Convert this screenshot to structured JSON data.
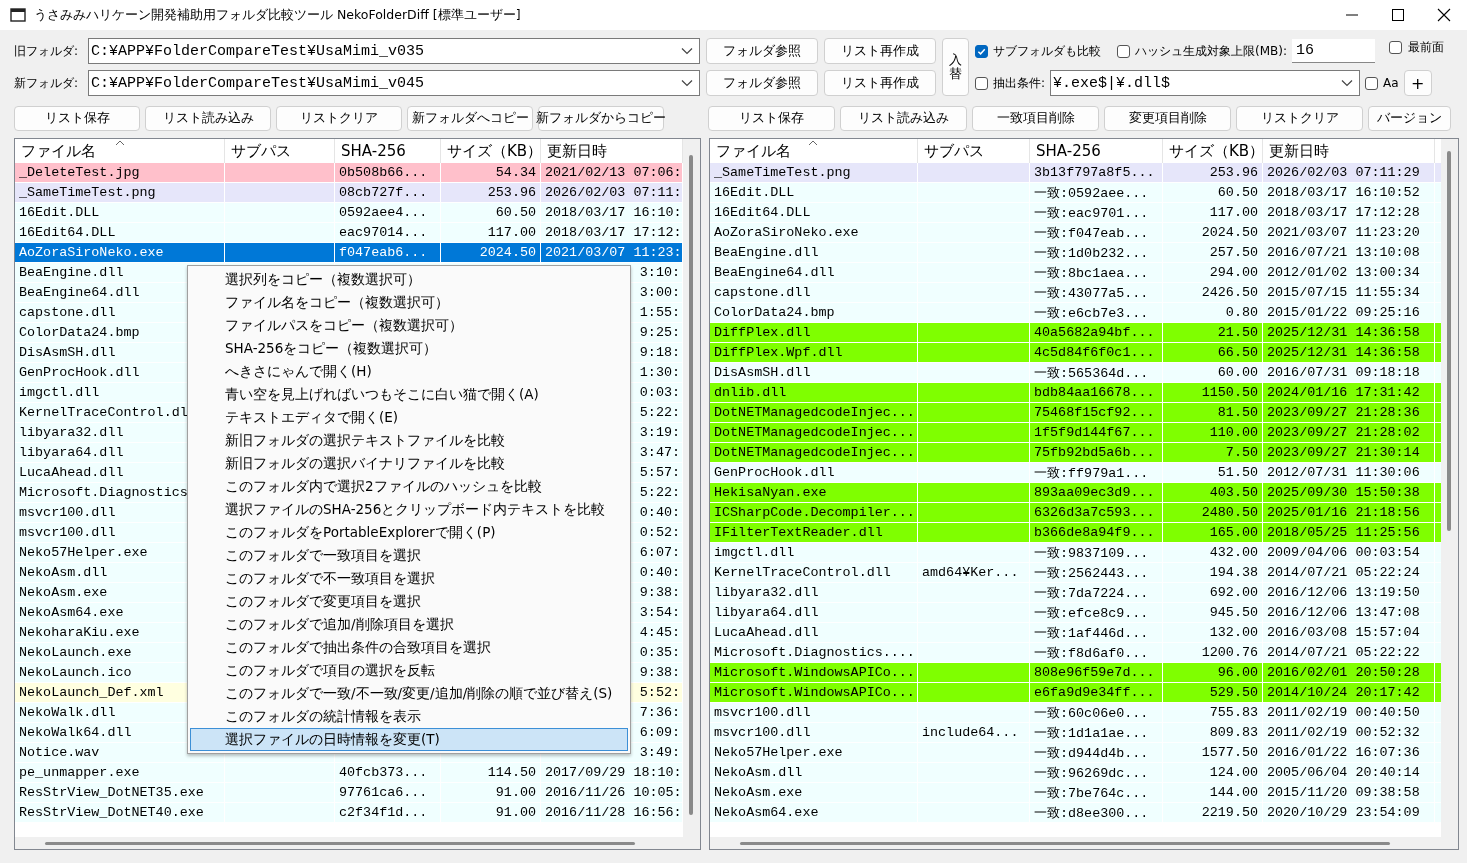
{
  "window": {
    "title": "うさみみハリケーン開発補助用フォルダ比較ツール NekoFolderDiff [標準ユーザー]"
  },
  "old_folder": {
    "label": "旧フォルダ:",
    "value": "C:¥APP¥FolderCompareTest¥UsaMimi_v035",
    "buttons": [
      "フォルダ参照",
      "リスト再作成"
    ]
  },
  "new_folder": {
    "label": "新フォルダ:",
    "value": "C:¥APP¥FolderCompareTest¥UsaMimi_v045",
    "buttons": [
      "フォルダ参照",
      "リスト再作成"
    ]
  },
  "swap_button": "入替",
  "compare_subfolders": {
    "label": "サブフォルダも比較",
    "checked": true
  },
  "hash_limit": {
    "label": "ハッシュ生成対象上限(MB):",
    "checked": false,
    "value": "16"
  },
  "topmost": {
    "label": "最前面",
    "checked": false
  },
  "filter": {
    "label": "抽出条件:",
    "checked": false,
    "value": "¥.exe$|¥.dll$"
  },
  "case_sensitive": {
    "label": "Aa",
    "checked": false
  },
  "add_button": "+",
  "left_buttons": [
    "リスト保存",
    "リスト読み込み",
    "リストクリア",
    "新フォルダへコピー",
    "新フォルダからコピー"
  ],
  "right_buttons": [
    "リスト保存",
    "リスト読み込み",
    "一致項目削除",
    "変更項目削除",
    "リストクリア",
    "バージョン"
  ],
  "left_list": {
    "columns": [
      "ファイル名",
      "サブパス",
      "SHA-256",
      "サイズ（KB）",
      "更新日時"
    ],
    "rows": [
      {
        "kind": "deleted",
        "selected": false,
        "name": "_DeleteTest.jpg",
        "sha": "0b508b66...",
        "size": "54.34",
        "modified": "2021/02/13 07:06:"
      },
      {
        "kind": "same_time",
        "selected": false,
        "name": "_SameTimeTest.png",
        "sha": "08cb727f...",
        "size": "253.96",
        "modified": "2026/02/03 07:11:"
      },
      {
        "kind": "match",
        "selected": false,
        "name": "16Edit.DLL",
        "sha": "0592aee4...",
        "size": "60.50",
        "modified": "2018/03/17 16:10:"
      },
      {
        "kind": "match",
        "selected": false,
        "name": "16Edit64.DLL",
        "sha": "eac97014...",
        "size": "117.00",
        "modified": "2018/03/17 17:12:"
      },
      {
        "selected": true,
        "name": "AoZoraSiroNeko.exe",
        "sha": "f047eab6...",
        "size": "2024.50",
        "modified": "2021/03/07 11:23:"
      },
      {
        "kind": "match",
        "selected": false,
        "name": "BeaEngine.dll",
        "modified": "3:10:"
      },
      {
        "kind": "match",
        "selected": false,
        "name": "BeaEngine64.dll",
        "modified": "3:00:"
      },
      {
        "kind": "match",
        "selected": false,
        "name": "capstone.dll",
        "modified": "1:55:"
      },
      {
        "kind": "match",
        "selected": false,
        "name": "ColorData24.bmp",
        "modified": "9:25:"
      },
      {
        "kind": "match",
        "selected": false,
        "name": "DisAsmSH.dll",
        "modified": "9:18:"
      },
      {
        "kind": "match",
        "selected": false,
        "name": "GenProcHook.dll",
        "modified": "1:30:"
      },
      {
        "kind": "match",
        "selected": false,
        "name": "imgctl.dll",
        "modified": "0:03:"
      },
      {
        "kind": "match",
        "selected": false,
        "name": "KernelTraceControl.dl",
        "modified": "5:22:"
      },
      {
        "kind": "match",
        "selected": false,
        "name": "libyara32.dll",
        "modified": "3:19:"
      },
      {
        "kind": "match",
        "selected": false,
        "name": "libyara64.dll",
        "modified": "3:47:"
      },
      {
        "kind": "match",
        "selected": false,
        "name": "LucaAhead.dll",
        "modified": "5:57:"
      },
      {
        "kind": "match",
        "selected": false,
        "name": "Microsoft.Diagnostics",
        "modified": "5:22:"
      },
      {
        "kind": "match",
        "selected": false,
        "name": "msvcr100.dll",
        "modified": "0:40:"
      },
      {
        "kind": "match",
        "selected": false,
        "name": "msvcr100.dll",
        "modified": "0:52:"
      },
      {
        "kind": "match",
        "selected": false,
        "name": "Neko57Helper.exe",
        "modified": "6:07:"
      },
      {
        "kind": "match",
        "selected": false,
        "name": "NekoAsm.dll",
        "modified": "0:40:"
      },
      {
        "kind": "match",
        "selected": false,
        "name": "NekoAsm.exe",
        "modified": "9:38:"
      },
      {
        "kind": "match",
        "selected": false,
        "name": "NekoAsm64.exe",
        "modified": "3:54:"
      },
      {
        "kind": "match",
        "selected": false,
        "name": "NekoharaKiu.exe",
        "modified": "4:45:"
      },
      {
        "kind": "match",
        "selected": false,
        "name": "NekoLaunch.exe",
        "modified": "0:35:"
      },
      {
        "kind": "match",
        "selected": false,
        "name": "NekoLaunch.ico",
        "modified": "9:38:"
      },
      {
        "kind": "changed",
        "selected": false,
        "name": "NekoLaunch_Def.xml",
        "modified": "5:52:"
      },
      {
        "kind": "match",
        "selected": false,
        "name": "NekoWalk.dll",
        "modified": "7:36:"
      },
      {
        "kind": "match",
        "selected": false,
        "name": "NekoWalk64.dll",
        "modified": "6:09:"
      },
      {
        "kind": "match",
        "selected": false,
        "name": "Notice.wav",
        "modified": "3:49:"
      },
      {
        "kind": "match",
        "selected": false,
        "name": "pe_unmapper.exe",
        "sha": "40fcb373...",
        "size": "114.50",
        "modified": "2017/09/29 18:10:"
      },
      {
        "kind": "match",
        "selected": false,
        "name": "ResStrView_DotNET35.exe",
        "sha": "97761ca6...",
        "size": "91.00",
        "modified": "2016/11/26 10:05:"
      },
      {
        "kind": "match",
        "selected": false,
        "name": "ResStrView_DotNET40.exe",
        "sha": "c2f34f1d...",
        "size": "91.00",
        "modified": "2016/11/28 16:56:"
      }
    ]
  },
  "right_list": {
    "columns": [
      "ファイル名",
      "サブパス",
      "SHA-256",
      "サイズ（KB）",
      "更新日時"
    ],
    "rows": [
      {
        "kind": "same_time",
        "selected": false,
        "name": "_SameTimeTest.png",
        "sha": "3b13f797a8f5...",
        "size": "253.96",
        "modified": "2026/02/03 07:11:29"
      },
      {
        "kind": "match",
        "selected": false,
        "name": "16Edit.DLL",
        "sha": "一致:0592aee...",
        "size": "60.50",
        "modified": "2018/03/17 16:10:52"
      },
      {
        "kind": "match",
        "selected": false,
        "name": "16Edit64.DLL",
        "sha": "一致:eac9701...",
        "size": "117.00",
        "modified": "2018/03/17 17:12:28"
      },
      {
        "kind": "match",
        "selected": false,
        "name": "AoZoraSiroNeko.exe",
        "sha": "一致:f047eab...",
        "size": "2024.50",
        "modified": "2021/03/07 11:23:20"
      },
      {
        "kind": "match",
        "selected": false,
        "name": "BeaEngine.dll",
        "sha": "一致:1d0b232...",
        "size": "257.50",
        "modified": "2016/07/21 13:10:08"
      },
      {
        "kind": "match",
        "selected": false,
        "name": "BeaEngine64.dll",
        "sha": "一致:8bc1aea...",
        "size": "294.00",
        "modified": "2012/01/02 13:00:34"
      },
      {
        "kind": "match",
        "selected": false,
        "name": "capstone.dll",
        "sha": "一致:43077a5...",
        "size": "2426.50",
        "modified": "2015/07/15 11:55:34"
      },
      {
        "kind": "match",
        "selected": false,
        "name": "ColorData24.bmp",
        "sha": "一致:e6cb7e3...",
        "size": "0.80",
        "modified": "2015/01/22 09:25:16"
      },
      {
        "kind": "added",
        "selected": false,
        "name": "DiffPlex.dll",
        "sha": "40a5682a94bf...",
        "size": "21.50",
        "modified": "2025/12/31 14:36:58"
      },
      {
        "kind": "added",
        "selected": false,
        "name": "DiffPlex.Wpf.dll",
        "sha": "4c5d84f6f0c1...",
        "size": "66.50",
        "modified": "2025/12/31 14:36:58"
      },
      {
        "kind": "match",
        "selected": false,
        "name": "DisAsmSH.dll",
        "sha": "一致:565364d...",
        "size": "60.00",
        "modified": "2016/07/31 09:18:18"
      },
      {
        "kind": "added",
        "selected": false,
        "name": "dnlib.dll",
        "sha": "bdb84aa16678...",
        "size": "1150.50",
        "modified": "2024/01/16 17:31:42"
      },
      {
        "kind": "added",
        "selected": false,
        "name": "DotNETManagedcodeInjec...",
        "sha": "75468f15cf92...",
        "size": "81.50",
        "modified": "2023/09/27 21:28:36"
      },
      {
        "kind": "added",
        "selected": false,
        "name": "DotNETManagedcodeInjec...",
        "sha": "1f5f9d144f67...",
        "size": "110.00",
        "modified": "2023/09/27 21:28:02"
      },
      {
        "kind": "added",
        "selected": false,
        "name": "DotNETManagedcodeInjec...",
        "sha": "75fb92bd5a6b...",
        "size": "7.50",
        "modified": "2023/09/27 21:30:14"
      },
      {
        "kind": "match",
        "selected": false,
        "name": "GenProcHook.dll",
        "sha": "一致:ff979a1...",
        "size": "51.50",
        "modified": "2012/07/31 11:30:06"
      },
      {
        "kind": "added",
        "selected": false,
        "name": "HekisaNyan.exe",
        "sha": "893aa09ec3d9...",
        "size": "403.50",
        "modified": "2025/09/30 15:50:38"
      },
      {
        "kind": "added",
        "selected": false,
        "name": "ICSharpCode.Decompiler...",
        "sha": "6326d3a7c593...",
        "size": "2480.50",
        "modified": "2025/01/16 21:18:56"
      },
      {
        "kind": "added",
        "selected": false,
        "name": "IFilterTextReader.dll",
        "sha": "b366de8a94f9...",
        "size": "165.00",
        "modified": "2018/05/25 11:25:56"
      },
      {
        "kind": "match",
        "selected": false,
        "name": "imgctl.dll",
        "sha": "一致:9837109...",
        "size": "432.00",
        "modified": "2009/04/06 00:03:54"
      },
      {
        "kind": "match",
        "selected": false,
        "name": "KernelTraceControl.dll",
        "subpath": "amd64¥Ker...",
        "sha": "一致:2562443...",
        "size": "194.38",
        "modified": "2014/07/21 05:22:24"
      },
      {
        "kind": "match",
        "selected": false,
        "name": "libyara32.dll",
        "sha": "一致:7da7224...",
        "size": "692.00",
        "modified": "2016/12/06 13:19:50"
      },
      {
        "kind": "match",
        "selected": false,
        "name": "libyara64.dll",
        "sha": "一致:efce8c9...",
        "size": "945.50",
        "modified": "2016/12/06 13:47:08"
      },
      {
        "kind": "match",
        "selected": false,
        "name": "LucaAhead.dll",
        "sha": "一致:1af446d...",
        "size": "132.00",
        "modified": "2016/03/08 15:57:04"
      },
      {
        "kind": "match",
        "selected": false,
        "name": "Microsoft.Diagnostics....",
        "sha": "一致:f8d6af0...",
        "size": "1200.76",
        "modified": "2014/07/21 05:22:22"
      },
      {
        "kind": "added",
        "selected": false,
        "name": "Microsoft.WindowsAPICo...",
        "sha": "808e96f59e7d...",
        "size": "96.00",
        "modified": "2016/02/01 20:50:28"
      },
      {
        "kind": "added",
        "selected": false,
        "name": "Microsoft.WindowsAPICo...",
        "sha": "e6fa9d9e34ff...",
        "size": "529.50",
        "modified": "2014/10/24 20:17:42"
      },
      {
        "kind": "match",
        "selected": false,
        "name": "msvcr100.dll",
        "sha": "一致:60c06e0...",
        "size": "755.83",
        "modified": "2011/02/19 00:40:50"
      },
      {
        "kind": "match",
        "selected": false,
        "name": "msvcr100.dll",
        "subpath": "include64...",
        "sha": "一致:1d1a1ae...",
        "size": "809.83",
        "modified": "2011/02/19 00:52:32"
      },
      {
        "kind": "match",
        "selected": false,
        "name": "Neko57Helper.exe",
        "sha": "一致:d944d4b...",
        "size": "1577.50",
        "modified": "2016/01/22 16:07:36"
      },
      {
        "kind": "match",
        "selected": false,
        "name": "NekoAsm.dll",
        "sha": "一致:96269dc...",
        "size": "124.00",
        "modified": "2005/06/04 20:40:14"
      },
      {
        "kind": "match",
        "selected": false,
        "name": "NekoAsm.exe",
        "sha": "一致:7be764c...",
        "size": "144.00",
        "modified": "2015/11/20 09:38:58"
      },
      {
        "kind": "match",
        "selected": false,
        "name": "NekoAsm64.exe",
        "sha": "一致:d8ee300...",
        "size": "2219.50",
        "modified": "2020/10/29 23:54:09"
      }
    ]
  },
  "context_menu": {
    "items": [
      {
        "label": "選択列をコピー（複数選択可）",
        "selected": false
      },
      {
        "label": "ファイル名をコピー（複数選択可）",
        "selected": false
      },
      {
        "label": "ファイルパスをコピー（複数選択可）",
        "selected": false
      },
      {
        "label": "SHA-256をコピー（複数選択可）",
        "selected": false
      },
      {
        "label": "へきさにゃんで開く(H)",
        "selected": false
      },
      {
        "label": "青い空を見上げればいつもそこに白い猫で開く(A)",
        "selected": false
      },
      {
        "label": "テキストエディタで開く(E)",
        "selected": false
      },
      {
        "label": "新旧フォルダの選択テキストファイルを比較",
        "selected": false
      },
      {
        "label": "新旧フォルダの選択バイナリファイルを比較",
        "selected": false
      },
      {
        "label": "このフォルダ内で選択2ファイルのハッシュを比較",
        "selected": false
      },
      {
        "label": "選択ファイルのSHA-256とクリップボード内テキストを比較",
        "selected": false
      },
      {
        "label": "このフォルダをPortableExplorerで開く(P)",
        "selected": false
      },
      {
        "label": "このフォルダで一致項目を選択",
        "selected": false
      },
      {
        "label": "このフォルダで不一致項目を選択",
        "selected": false
      },
      {
        "label": "このフォルダで変更項目を選択",
        "selected": false
      },
      {
        "label": "このフォルダで追加/削除項目を選択",
        "selected": false
      },
      {
        "label": "このフォルダで抽出条件の合致項目を選択",
        "selected": false
      },
      {
        "label": "このフォルダで項目の選択を反転",
        "selected": false
      },
      {
        "label": "このフォルダで一致/不一致/変更/追加/削除の順で並び替え(S)",
        "selected": false
      },
      {
        "label": "このフォルダの統計情報を表示",
        "selected": false
      },
      {
        "label": "選択ファイルの日時情報を変更(T)",
        "selected": true
      }
    ]
  }
}
